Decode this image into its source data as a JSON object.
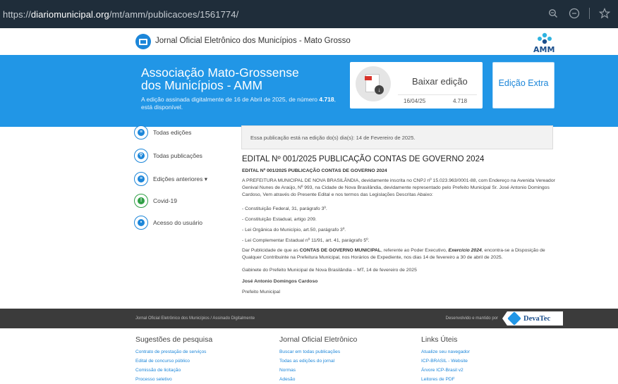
{
  "browser": {
    "url_prefix": "https://",
    "url_domain": "diariomunicipal.org",
    "url_path": "/mt/amm/publicacoes/1561774/",
    "icons": [
      "zoom-icon",
      "reader-icon",
      "star-icon"
    ]
  },
  "header": {
    "site_title": "Jornal Oficial Eletrônico dos Municípios - Mato Grosso",
    "logo_text": "AMM"
  },
  "banner": {
    "org_name": "Associação Mato-Grossense dos Municípios - AMM",
    "edition_text_prefix": "A edição assinada digitalmente de 16 de Abril de 2025, de número",
    "edition_number": "4.718",
    "edition_text_suffix": ", está disponível.",
    "download_label": "Baixar edição",
    "download_date": "16/04/25",
    "download_number": "4.718",
    "extra_label": "Edição Extra"
  },
  "sidebar": {
    "items": [
      {
        "label": "Todas edições",
        "icon": "list-icon"
      },
      {
        "label": "Todas publicações",
        "icon": "search-icon"
      },
      {
        "label": "Edições anteriores ▾",
        "icon": "menu-icon"
      },
      {
        "label": "Covid-19",
        "icon": "warning-icon"
      },
      {
        "label": "Acesso do usuário",
        "icon": "lock-icon"
      }
    ]
  },
  "notice": "Essa publicação está na edição do(s) dia(s): 14 de Fevereiro de 2025.",
  "article": {
    "title": "EDITAL Nº 001/2025 PUBLICAÇÃO CONTAS DE GOVERNO 2024",
    "subtitle": "EDITAL Nº 001/2025 PUBLICAÇÃO CONTAS DE GOVERNO 2024",
    "intro": "A PREFEITURA MUNICIPAL DE NOVA BRASILÂNDIA, devidamente inscrita no CNPJ nº 15.023.963/0001-88, com Endereço na Avenida Vereador Genival Nunes de Araújo, Nº 993, na Cidade de Nova Brasilândia, devidamente representado pelo Prefeito Municipal Sr. José Antonio Domingos Cardoso, Vem através do Presente Edital e nos termos das Legislações Descritas Abaixo:",
    "laws": [
      "- Constituição Federal, 31, parágrafo 3º.",
      "- Constituição Estadual, artigo 209.",
      "- Lei Orgânica do Município, art.50, parágrafo 3º.",
      "- Lei Complementar Estadual nº 11/91, art. 41, parágrafo 5º."
    ],
    "body_pre": "Dar Publicidade de que as ",
    "body_bold1": "CONTAS DE GOVERNO MUNICIPAL",
    "body_mid": ", referente ao Poder Executivo, ",
    "body_bold2": "Exercício 2024",
    "body_post": ", encontra-se a Disposição de Qualquer Contribuinte na Prefeitura Municipal, nos Horários de Expediente, nos dias 14 de fevereiro a 30 de abril de 2025.",
    "place_date": "Gabinete do Prefeito Municipal de Nova Brasilândia – MT, 14 de fevereiro de 2025",
    "signer": "José Antonio Domingos Cardoso",
    "signer_role": "Prefeito Municipal"
  },
  "footer": {
    "left_text": "Jornal Oficial Eletrônico dos Municípios / Assinado Digitalmente",
    "right_text": "Desenvolvido e mantido por",
    "brand": "DevaTec"
  },
  "links": {
    "col1": {
      "title": "Sugestões de pesquisa",
      "items": [
        "Contrato de prestação de serviços",
        "Edital de concurso público",
        "Comissão de licitação",
        "Processo seletivo"
      ]
    },
    "col2": {
      "title": "Jornal Oficial Eletrônico",
      "items": [
        "Buscar em todas publicações",
        "Todas as edições do jornal",
        "Normas",
        "Adesão"
      ]
    },
    "col3": {
      "title": "Links Úteis",
      "items": [
        "Atualize seu navegador",
        "ICP-BRASIL - Website",
        "Árvore ICP-Brasil v2",
        "Leitores de PDF"
      ]
    }
  },
  "colors": {
    "accent": "#2196e6",
    "dark": "#1f2d3a",
    "footer": "#3b3b3b",
    "green": "#2f9f45"
  }
}
